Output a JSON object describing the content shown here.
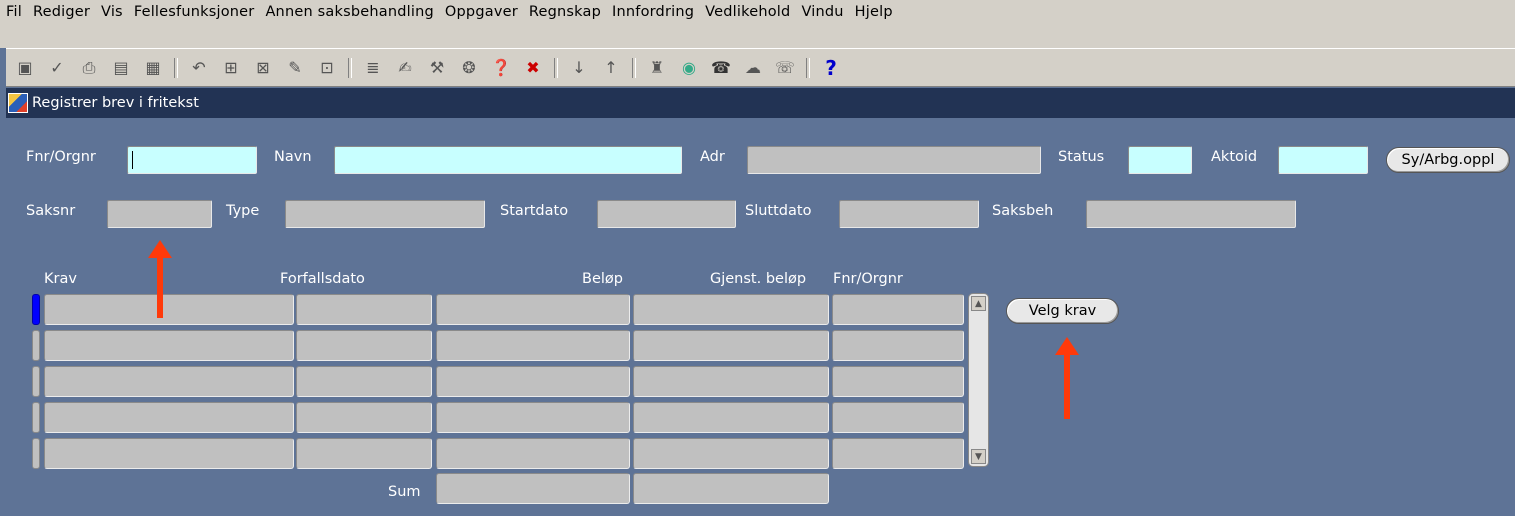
{
  "menu": [
    {
      "label": "Fil"
    },
    {
      "label": "Rediger"
    },
    {
      "label": "Vis"
    },
    {
      "label": "Fellesfunksjoner"
    },
    {
      "label": "Annen saksbehandling"
    },
    {
      "label": "Oppgaver"
    },
    {
      "label": "Regnskap"
    },
    {
      "label": "Innfordring"
    },
    {
      "label": "Vedlikehold"
    },
    {
      "label": "Vindu"
    },
    {
      "label": "Hjelp"
    }
  ],
  "toolbar": {
    "icons": [
      "save-icon",
      "checkmark-icon",
      "print-icon",
      "calculator-icon",
      "document-icon",
      "undo-icon",
      "insert-record-icon",
      "delete-record-icon",
      "clear-icon",
      "query-icon",
      "list-icon",
      "edit-icon",
      "tools-icon",
      "help-search-icon",
      "help-icon",
      "cancel-icon",
      "down-arrow-icon",
      "up-arrow-icon",
      "hierarchy-icon",
      "globe-icon",
      "phone-icon",
      "speech-icon",
      "fax-icon",
      "question-icon"
    ],
    "question_glyph": "?"
  },
  "window": {
    "title": "Registrer brev i fritekst"
  },
  "form": {
    "fnr_label": "Fnr/Orgnr",
    "navn_label": "Navn",
    "adr_label": "Adr",
    "status_label": "Status",
    "aktoid_label": "Aktoid",
    "sy_button": "Sy/Arbg.oppl",
    "saksnr_label": "Saksnr",
    "type_label": "Type",
    "startdato_label": "Startdato",
    "sluttdato_label": "Sluttdato",
    "saksbeh_label": "Saksbeh"
  },
  "table": {
    "headers": [
      "Krav",
      "Forfallsdato",
      "Beløp",
      "Gjenst. beløp",
      "Fnr/Orgnr"
    ],
    "rows": 5,
    "sum_label": "Sum"
  },
  "velg_button": "Velg krav",
  "colors": {
    "background": "#5e7396",
    "cyan_field": "#c8ffff",
    "annotation_arrow": "#ff3a0a",
    "title_bar": "#223354"
  }
}
